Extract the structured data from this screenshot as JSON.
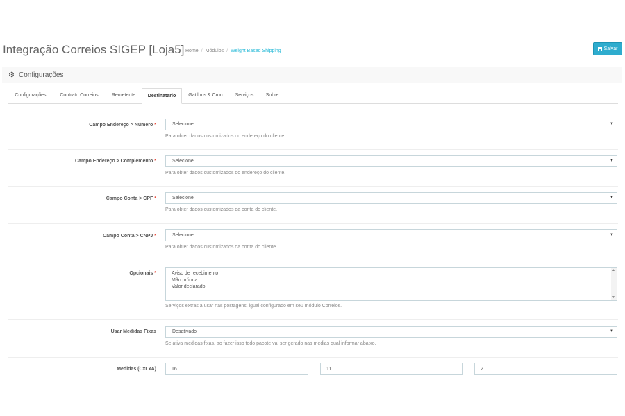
{
  "header": {
    "title": "Integração Correios SIGEP [Loja5]",
    "breadcrumb": [
      "Home",
      "Módulos",
      "Weight Based Shipping"
    ],
    "save_label": "Salvar"
  },
  "panel": {
    "title": "Configurações",
    "tabs": [
      {
        "label": "Configurações"
      },
      {
        "label": "Contrato Correios"
      },
      {
        "label": "Remetente"
      },
      {
        "label": "Destinatario"
      },
      {
        "label": "Gatilhos & Cron"
      },
      {
        "label": "Serviços"
      },
      {
        "label": "Sobre"
      }
    ],
    "active_tab": "Destinatario"
  },
  "form": {
    "numero": {
      "label": "Campo Endereço > Número",
      "value": "Selecione",
      "help": "Para obter dados customizados do endereço do cliente."
    },
    "complemento": {
      "label": "Campo Endereço > Complemento",
      "value": "Selecione",
      "help": "Para obter dados customizados do endereço do cliente."
    },
    "cpf": {
      "label": "Campo Conta > CPF",
      "value": "Selecione",
      "help": "Para obter dados customizados da conta do cliente."
    },
    "cnpj": {
      "label": "Campo Conta > CNPJ",
      "value": "Selecione",
      "help": "Para obter dados customizados da conta do cliente."
    },
    "opcionais": {
      "label": "Opcionais",
      "options": [
        "Aviso de recebimento",
        "Mão própria",
        "Valor declarado"
      ],
      "help": "Serviços extras a usar nas postagens, igual configurado em seu módulo Correios."
    },
    "medidas_fixas": {
      "label": "Usar Medidas Fixas",
      "value": "Desativado",
      "help": "Se ativa medidas fixas, ao fazer isso todo pacote vai ser gerado nas medias qual informar abaixo."
    },
    "medidas": {
      "label": "Medidas (CxLxA)",
      "c": "16",
      "l": "11",
      "a": "2"
    },
    "required_mark": "*"
  },
  "colors": {
    "accent": "#25b9d7",
    "save_button": "#2eacce",
    "required": "#e74c3c"
  }
}
